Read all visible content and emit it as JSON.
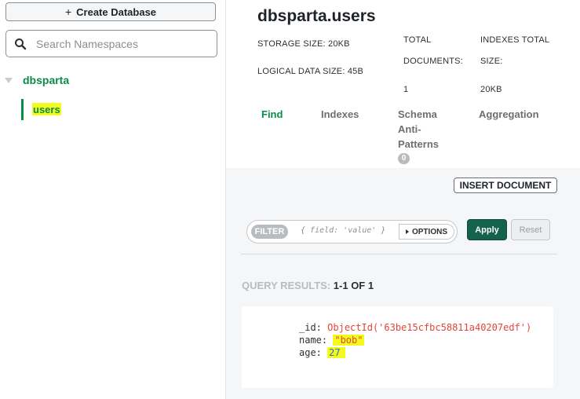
{
  "sidebar": {
    "create_database_label": "Create Database",
    "search_placeholder": "Search Namespaces",
    "database": "dbsparta",
    "collection": "users"
  },
  "header": {
    "title": "dbsparta.users",
    "storage_size": "STORAGE SIZE: 20KB",
    "logical_data_size": "LOGICAL DATA SIZE: 45B",
    "total_documents_label_1": "TOTAL",
    "total_documents_label_2": "DOCUMENTS:",
    "total_documents_value": "1",
    "indexes_total_label_1": "INDEXES TOTAL",
    "indexes_total_label_2": "SIZE:",
    "indexes_total_value": "20KB"
  },
  "tabs": {
    "find": "Find",
    "indexes": "Indexes",
    "schema_1": "Schema",
    "schema_2": "Anti-",
    "schema_3": "Patterns",
    "schema_badge": "0",
    "aggregation": "Aggregation"
  },
  "toolbar": {
    "insert_document": "INSERT DOCUMENT",
    "filter_tag": "FILTER",
    "filter_placeholder": "{ field: 'value' }",
    "options": "OPTIONS",
    "apply": "Apply",
    "reset": "Reset"
  },
  "results": {
    "label": "QUERY RESULTS:",
    "count": "1-1 OF 1",
    "document": {
      "id_key": "_id:",
      "id_value": "ObjectId('63be15cfbc58811a40207edf')",
      "name_key": "name:",
      "name_value": "\"bob\"",
      "age_key": "age:",
      "age_value": "27"
    }
  },
  "colors": {
    "accent_green": "#0b8a48",
    "apply_green": "#14624a",
    "highlight": "#f4fb1c",
    "objectid_red": "#e2453a"
  }
}
